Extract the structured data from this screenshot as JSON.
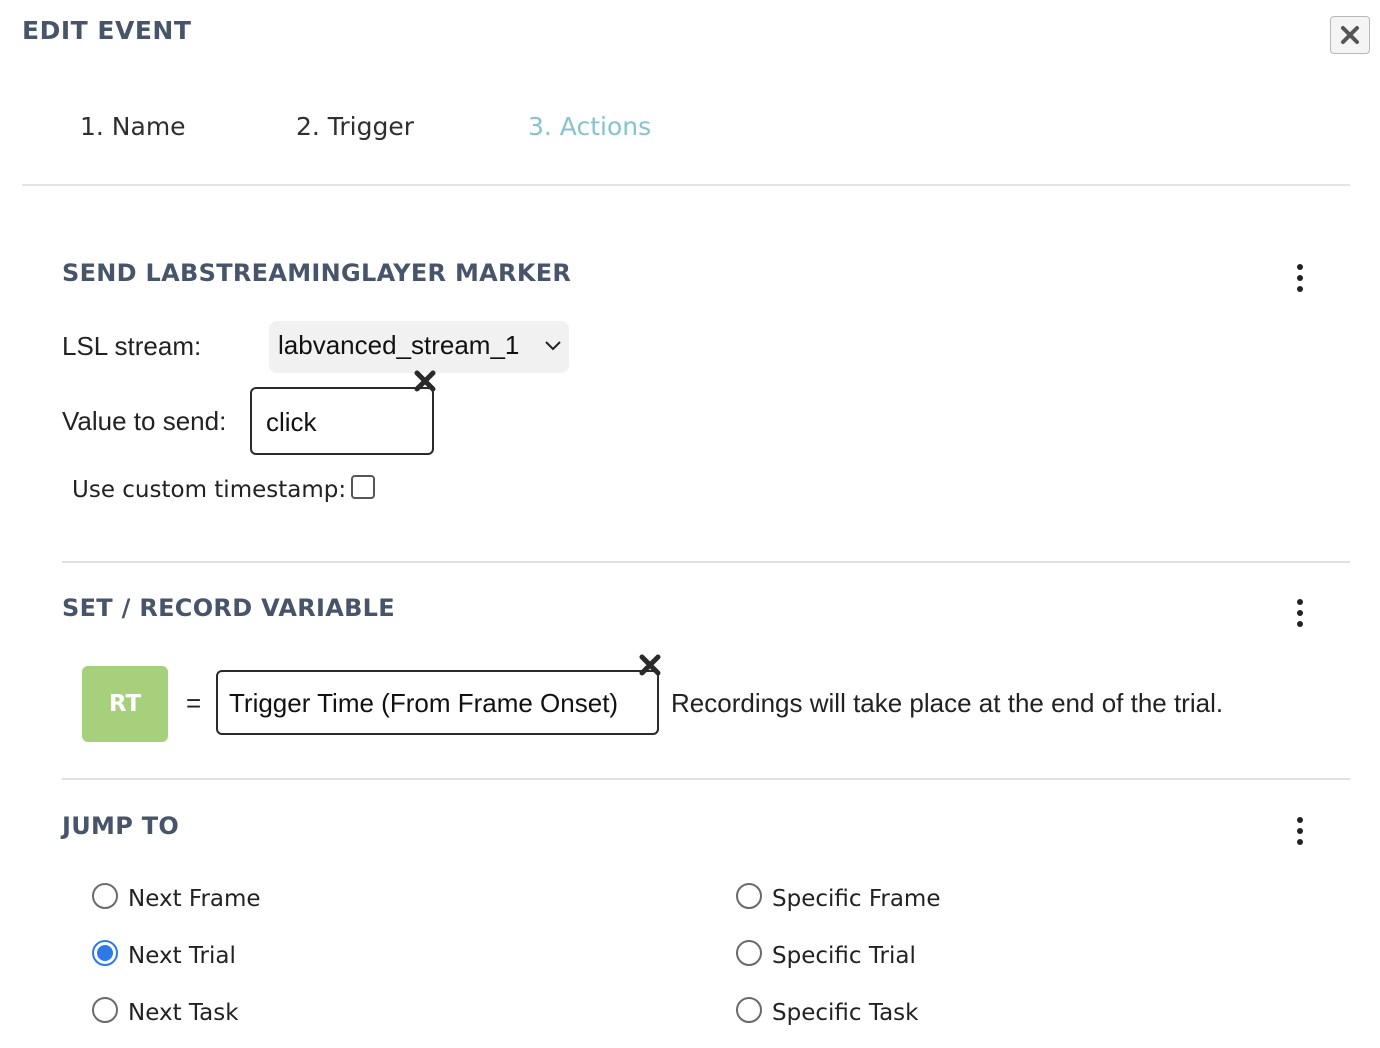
{
  "dialog": {
    "title": "EDIT EVENT",
    "close_icon": "close-icon"
  },
  "tabs": [
    {
      "label": "1. Name",
      "active": false
    },
    {
      "label": "2. Trigger",
      "active": false
    },
    {
      "label": "3. Actions",
      "active": true
    }
  ],
  "actions": {
    "lsl_marker": {
      "title": "SEND LABSTREAMINGLAYER MARKER",
      "stream_label": "LSL stream:",
      "stream_value": "labvanced_stream_1",
      "value_label": "Value to send:",
      "value": "click",
      "custom_timestamp_label": "Use custom timestamp:",
      "custom_timestamp_checked": false
    },
    "set_variable": {
      "title": "SET / RECORD VARIABLE",
      "variable_name": "RT",
      "equals": "=",
      "value": "Trigger Time (From Frame Onset)",
      "note": "Recordings will take place at the end of the trial."
    },
    "jump_to": {
      "title": "JUMP TO",
      "options": [
        {
          "label": "Next Frame",
          "checked": false
        },
        {
          "label": "Next Trial",
          "checked": true
        },
        {
          "label": "Next Task",
          "checked": false
        },
        {
          "label": "Specific Frame",
          "checked": false
        },
        {
          "label": "Specific Trial",
          "checked": false
        },
        {
          "label": "Specific Task",
          "checked": false
        }
      ]
    }
  },
  "colors": {
    "heading": "#475469",
    "active_tab": "#86c2d0",
    "variable_badge": "#a6d07c",
    "radio_checked": "#2e79e8"
  }
}
